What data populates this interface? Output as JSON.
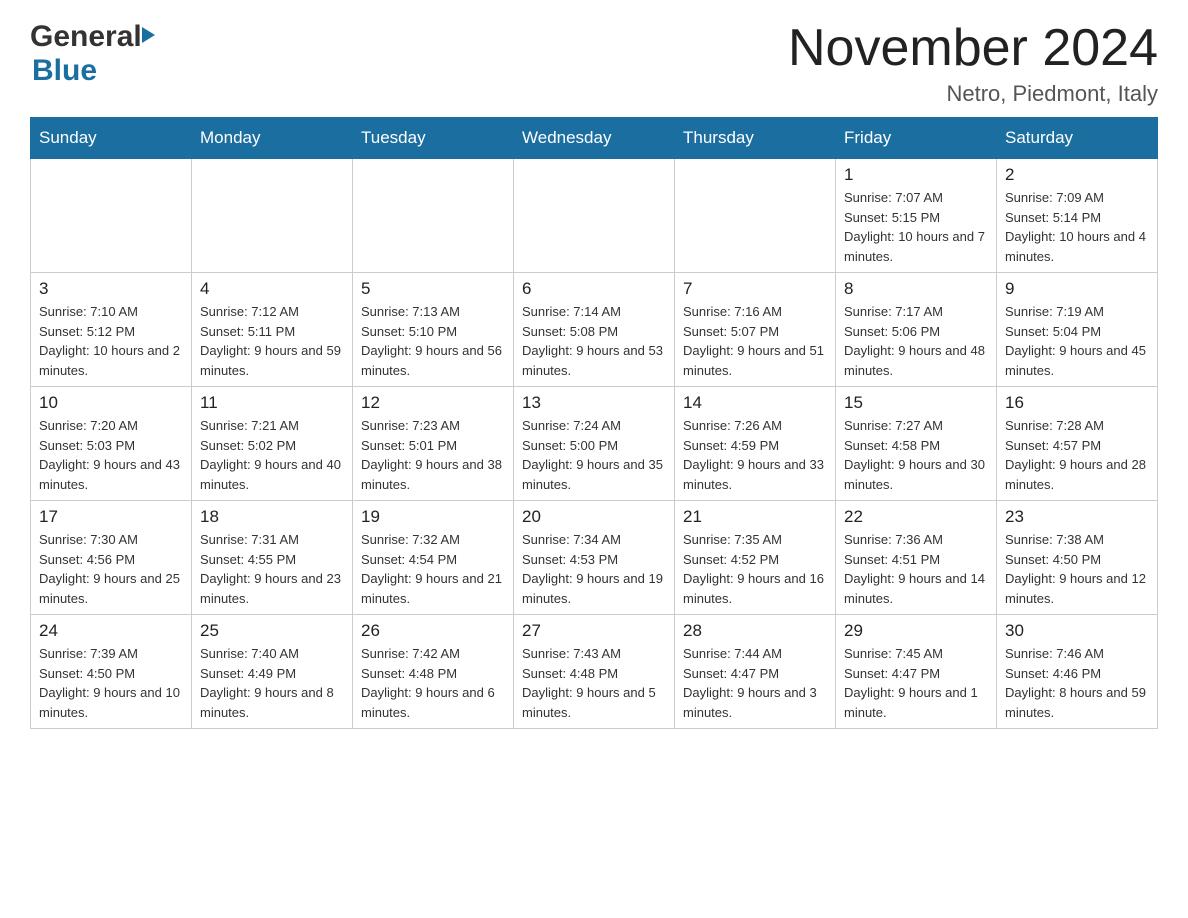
{
  "header": {
    "month_title": "November 2024",
    "location": "Netro, Piedmont, Italy"
  },
  "weekdays": [
    "Sunday",
    "Monday",
    "Tuesday",
    "Wednesday",
    "Thursday",
    "Friday",
    "Saturday"
  ],
  "weeks": [
    [
      {
        "day": "",
        "sunrise": "",
        "sunset": "",
        "daylight": ""
      },
      {
        "day": "",
        "sunrise": "",
        "sunset": "",
        "daylight": ""
      },
      {
        "day": "",
        "sunrise": "",
        "sunset": "",
        "daylight": ""
      },
      {
        "day": "",
        "sunrise": "",
        "sunset": "",
        "daylight": ""
      },
      {
        "day": "",
        "sunrise": "",
        "sunset": "",
        "daylight": ""
      },
      {
        "day": "1",
        "sunrise": "Sunrise: 7:07 AM",
        "sunset": "Sunset: 5:15 PM",
        "daylight": "Daylight: 10 hours and 7 minutes."
      },
      {
        "day": "2",
        "sunrise": "Sunrise: 7:09 AM",
        "sunset": "Sunset: 5:14 PM",
        "daylight": "Daylight: 10 hours and 4 minutes."
      }
    ],
    [
      {
        "day": "3",
        "sunrise": "Sunrise: 7:10 AM",
        "sunset": "Sunset: 5:12 PM",
        "daylight": "Daylight: 10 hours and 2 minutes."
      },
      {
        "day": "4",
        "sunrise": "Sunrise: 7:12 AM",
        "sunset": "Sunset: 5:11 PM",
        "daylight": "Daylight: 9 hours and 59 minutes."
      },
      {
        "day": "5",
        "sunrise": "Sunrise: 7:13 AM",
        "sunset": "Sunset: 5:10 PM",
        "daylight": "Daylight: 9 hours and 56 minutes."
      },
      {
        "day": "6",
        "sunrise": "Sunrise: 7:14 AM",
        "sunset": "Sunset: 5:08 PM",
        "daylight": "Daylight: 9 hours and 53 minutes."
      },
      {
        "day": "7",
        "sunrise": "Sunrise: 7:16 AM",
        "sunset": "Sunset: 5:07 PM",
        "daylight": "Daylight: 9 hours and 51 minutes."
      },
      {
        "day": "8",
        "sunrise": "Sunrise: 7:17 AM",
        "sunset": "Sunset: 5:06 PM",
        "daylight": "Daylight: 9 hours and 48 minutes."
      },
      {
        "day": "9",
        "sunrise": "Sunrise: 7:19 AM",
        "sunset": "Sunset: 5:04 PM",
        "daylight": "Daylight: 9 hours and 45 minutes."
      }
    ],
    [
      {
        "day": "10",
        "sunrise": "Sunrise: 7:20 AM",
        "sunset": "Sunset: 5:03 PM",
        "daylight": "Daylight: 9 hours and 43 minutes."
      },
      {
        "day": "11",
        "sunrise": "Sunrise: 7:21 AM",
        "sunset": "Sunset: 5:02 PM",
        "daylight": "Daylight: 9 hours and 40 minutes."
      },
      {
        "day": "12",
        "sunrise": "Sunrise: 7:23 AM",
        "sunset": "Sunset: 5:01 PM",
        "daylight": "Daylight: 9 hours and 38 minutes."
      },
      {
        "day": "13",
        "sunrise": "Sunrise: 7:24 AM",
        "sunset": "Sunset: 5:00 PM",
        "daylight": "Daylight: 9 hours and 35 minutes."
      },
      {
        "day": "14",
        "sunrise": "Sunrise: 7:26 AM",
        "sunset": "Sunset: 4:59 PM",
        "daylight": "Daylight: 9 hours and 33 minutes."
      },
      {
        "day": "15",
        "sunrise": "Sunrise: 7:27 AM",
        "sunset": "Sunset: 4:58 PM",
        "daylight": "Daylight: 9 hours and 30 minutes."
      },
      {
        "day": "16",
        "sunrise": "Sunrise: 7:28 AM",
        "sunset": "Sunset: 4:57 PM",
        "daylight": "Daylight: 9 hours and 28 minutes."
      }
    ],
    [
      {
        "day": "17",
        "sunrise": "Sunrise: 7:30 AM",
        "sunset": "Sunset: 4:56 PM",
        "daylight": "Daylight: 9 hours and 25 minutes."
      },
      {
        "day": "18",
        "sunrise": "Sunrise: 7:31 AM",
        "sunset": "Sunset: 4:55 PM",
        "daylight": "Daylight: 9 hours and 23 minutes."
      },
      {
        "day": "19",
        "sunrise": "Sunrise: 7:32 AM",
        "sunset": "Sunset: 4:54 PM",
        "daylight": "Daylight: 9 hours and 21 minutes."
      },
      {
        "day": "20",
        "sunrise": "Sunrise: 7:34 AM",
        "sunset": "Sunset: 4:53 PM",
        "daylight": "Daylight: 9 hours and 19 minutes."
      },
      {
        "day": "21",
        "sunrise": "Sunrise: 7:35 AM",
        "sunset": "Sunset: 4:52 PM",
        "daylight": "Daylight: 9 hours and 16 minutes."
      },
      {
        "day": "22",
        "sunrise": "Sunrise: 7:36 AM",
        "sunset": "Sunset: 4:51 PM",
        "daylight": "Daylight: 9 hours and 14 minutes."
      },
      {
        "day": "23",
        "sunrise": "Sunrise: 7:38 AM",
        "sunset": "Sunset: 4:50 PM",
        "daylight": "Daylight: 9 hours and 12 minutes."
      }
    ],
    [
      {
        "day": "24",
        "sunrise": "Sunrise: 7:39 AM",
        "sunset": "Sunset: 4:50 PM",
        "daylight": "Daylight: 9 hours and 10 minutes."
      },
      {
        "day": "25",
        "sunrise": "Sunrise: 7:40 AM",
        "sunset": "Sunset: 4:49 PM",
        "daylight": "Daylight: 9 hours and 8 minutes."
      },
      {
        "day": "26",
        "sunrise": "Sunrise: 7:42 AM",
        "sunset": "Sunset: 4:48 PM",
        "daylight": "Daylight: 9 hours and 6 minutes."
      },
      {
        "day": "27",
        "sunrise": "Sunrise: 7:43 AM",
        "sunset": "Sunset: 4:48 PM",
        "daylight": "Daylight: 9 hours and 5 minutes."
      },
      {
        "day": "28",
        "sunrise": "Sunrise: 7:44 AM",
        "sunset": "Sunset: 4:47 PM",
        "daylight": "Daylight: 9 hours and 3 minutes."
      },
      {
        "day": "29",
        "sunrise": "Sunrise: 7:45 AM",
        "sunset": "Sunset: 4:47 PM",
        "daylight": "Daylight: 9 hours and 1 minute."
      },
      {
        "day": "30",
        "sunrise": "Sunrise: 7:46 AM",
        "sunset": "Sunset: 4:46 PM",
        "daylight": "Daylight: 8 hours and 59 minutes."
      }
    ]
  ]
}
